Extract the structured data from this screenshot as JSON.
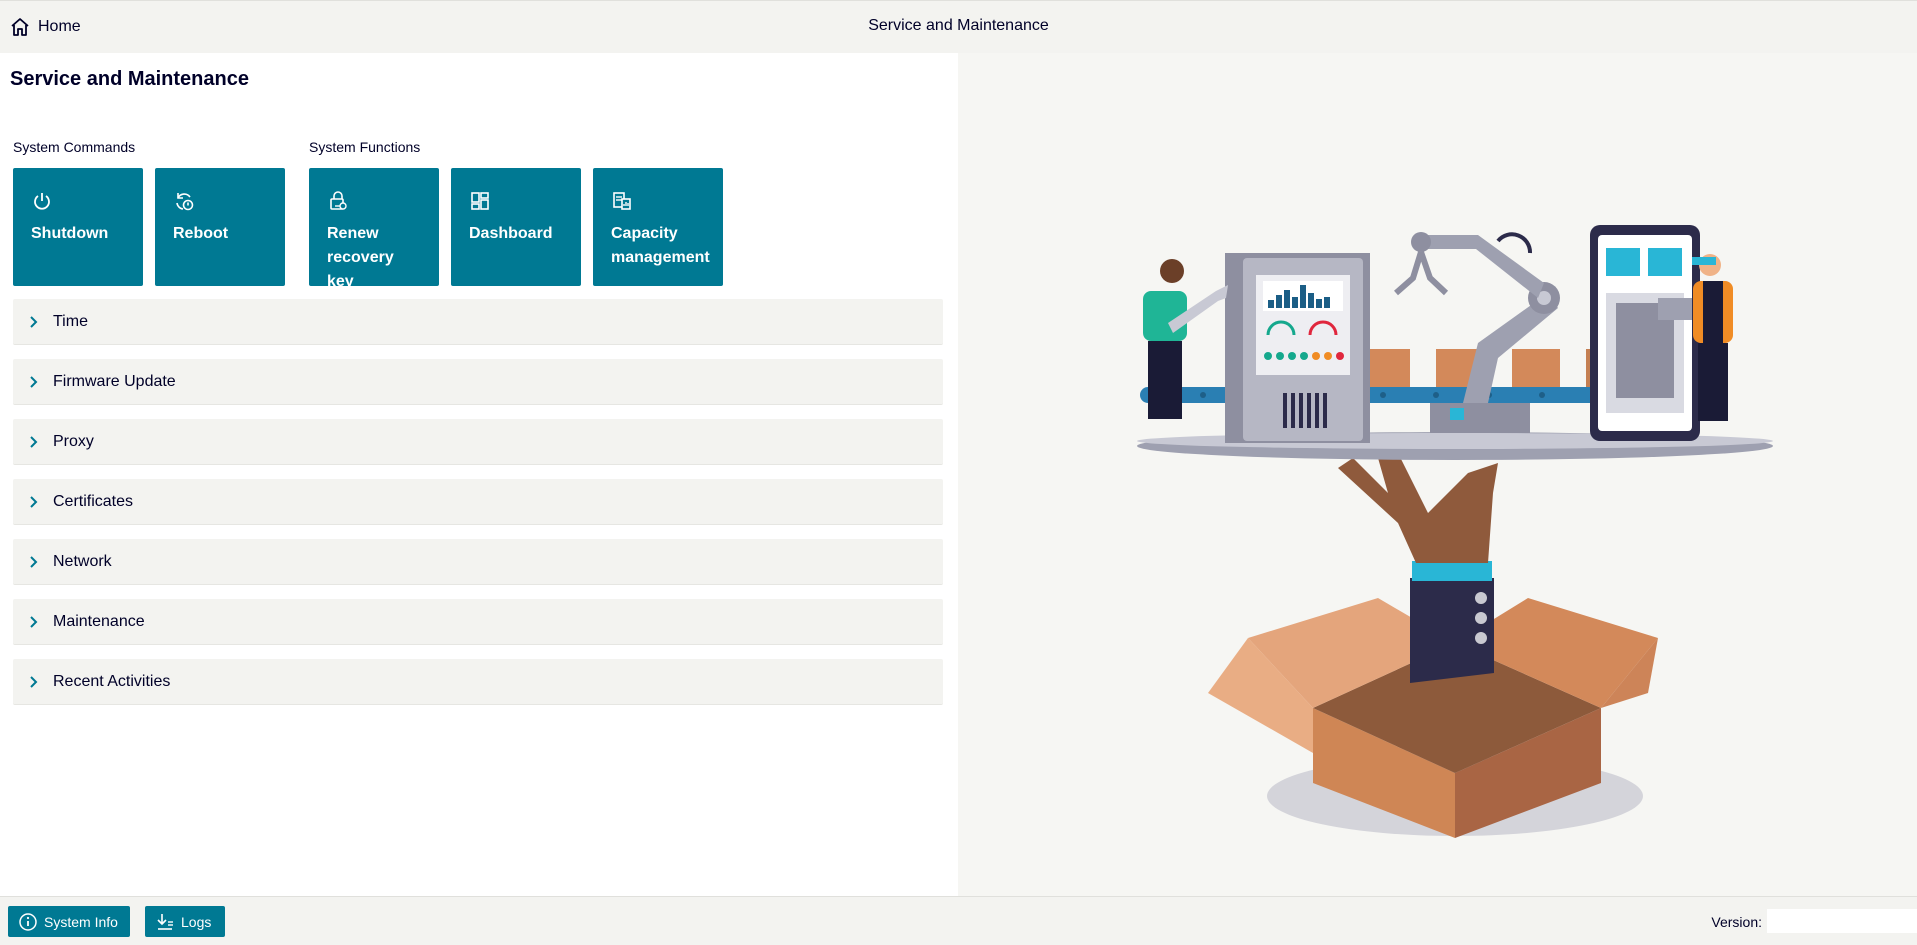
{
  "header": {
    "home_label": "Home",
    "title": "Service and Maintenance"
  },
  "main": {
    "title": "Service and Maintenance",
    "system_commands": {
      "label": "System Commands",
      "tiles": [
        {
          "label": "Shutdown",
          "icon": "power-icon"
        },
        {
          "label": "Reboot",
          "icon": "reboot-icon"
        }
      ]
    },
    "system_functions": {
      "label": "System Functions",
      "tiles": [
        {
          "label": "Renew recovery key",
          "icon": "lock-key-icon"
        },
        {
          "label": "Dashboard",
          "icon": "dashboard-icon"
        },
        {
          "label": "Capacity management",
          "icon": "capacity-icon"
        }
      ]
    },
    "sections": [
      {
        "label": "Time"
      },
      {
        "label": "Firmware Update"
      },
      {
        "label": "Proxy"
      },
      {
        "label": "Certificates"
      },
      {
        "label": "Network"
      },
      {
        "label": "Maintenance"
      },
      {
        "label": "Recent Activities"
      }
    ]
  },
  "footer": {
    "system_info_label": "System Info",
    "logs_label": "Logs",
    "version_label": "Version:"
  },
  "colors": {
    "accent": "#007993",
    "text": "#000028",
    "panel_bg": "#f3f3f0"
  }
}
